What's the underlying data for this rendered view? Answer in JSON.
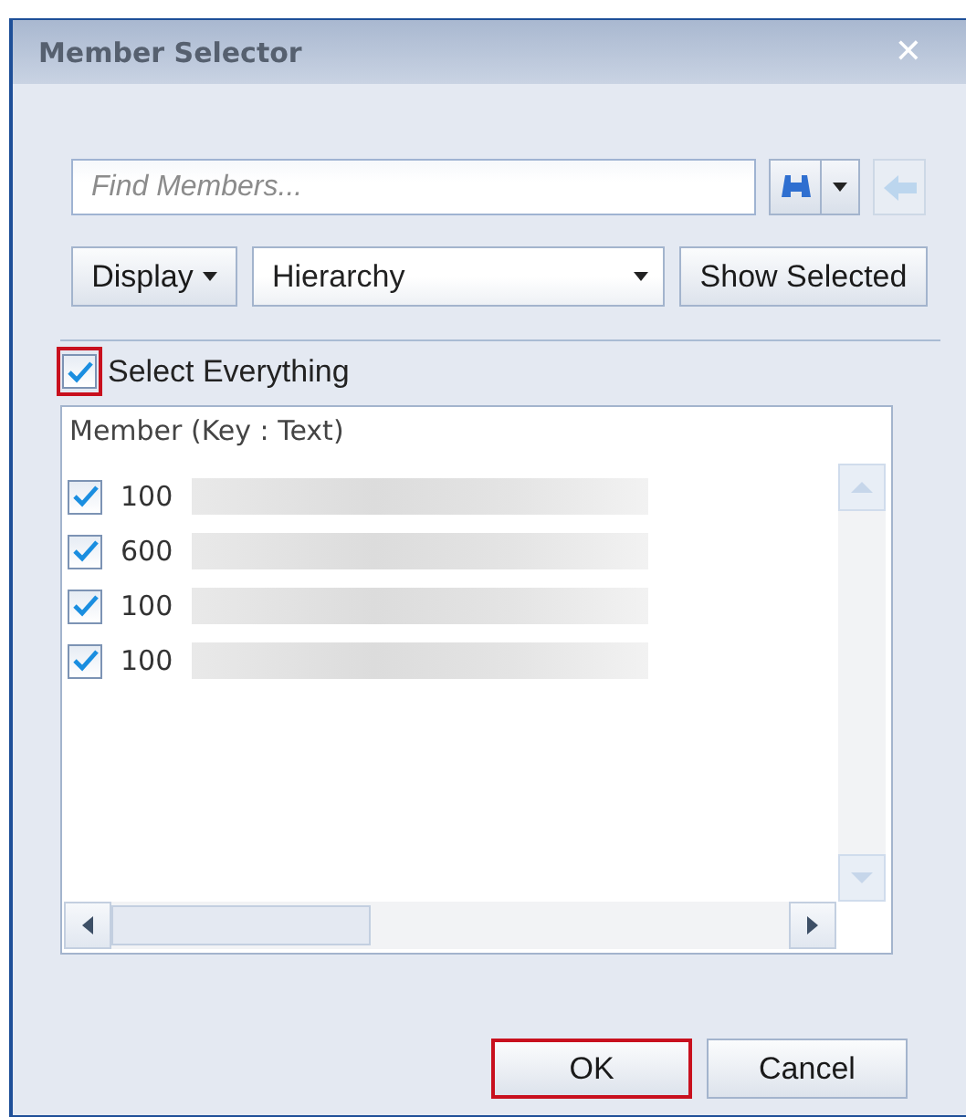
{
  "window": {
    "title": "Member Selector",
    "close": "✕"
  },
  "search": {
    "placeholder": "Find Members...",
    "back_disabled": true
  },
  "toolbar": {
    "display": "Display",
    "view": "Hierarchy",
    "show_selected": "Show Selected"
  },
  "select_all": {
    "label": "Select Everything",
    "checked": true,
    "highlighted": true
  },
  "list": {
    "header": "Member (Key : Text)",
    "rows": [
      {
        "key": "100",
        "checked": true
      },
      {
        "key": "600",
        "checked": true
      },
      {
        "key": "100",
        "checked": true
      },
      {
        "key": "100",
        "checked": true
      }
    ]
  },
  "buttons": [
    {
      "label": "OK",
      "highlighted": true
    },
    {
      "label": "Cancel",
      "highlighted": false
    }
  ]
}
